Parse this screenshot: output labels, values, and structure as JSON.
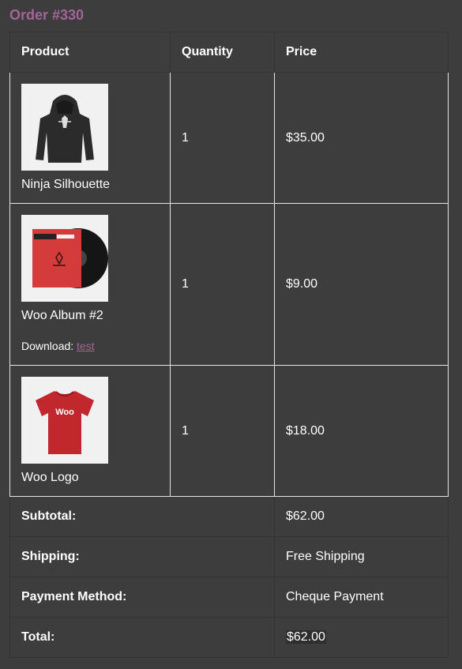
{
  "order": {
    "title": "Order #330"
  },
  "columns": {
    "product": "Product",
    "quantity": "Quantity",
    "price": "Price"
  },
  "items": [
    {
      "name": "Ninja Silhouette",
      "quantity": "1",
      "price": "$35.00",
      "image": "hoodie-image",
      "image_color": "#2b2b2b"
    },
    {
      "name": "Woo Album #2",
      "quantity": "1",
      "price": "$9.00",
      "image": "vinyl-album-image",
      "image_color": "#d43b3b",
      "download": {
        "label": "Download:",
        "link": "test"
      }
    },
    {
      "name": "Woo Logo",
      "quantity": "1",
      "price": "$18.00",
      "image": "tshirt-image",
      "image_color": "#c0282d",
      "shirt_text": "Woo"
    }
  ],
  "totals": [
    {
      "label": "Subtotal:",
      "value": "$62.00"
    },
    {
      "label": "Shipping:",
      "value": "Free Shipping"
    },
    {
      "label": "Payment Method:",
      "value": "Cheque Payment"
    },
    {
      "label": "Total:",
      "value": "$62.00"
    }
  ],
  "colors": {
    "background": "#3d3d3d",
    "accent": "#a46497",
    "text": "#ffffff"
  }
}
